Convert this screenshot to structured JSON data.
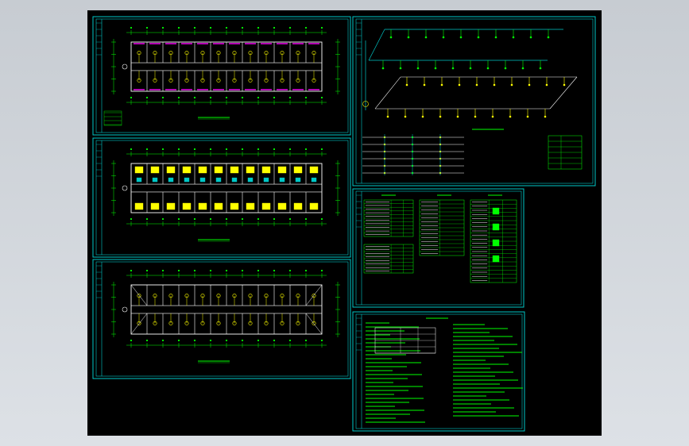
{
  "drawing": {
    "background_color": "#000000",
    "viewport_color": "#cfd4da",
    "frame_color": "#00c8c8",
    "line_color": "#ffff00",
    "text_color": "#00ff00",
    "accent_color": "#ff00ff",
    "white_color": "#ffffff",
    "sheets": [
      {
        "name": "floor-plan-upper"
      },
      {
        "name": "floor-plan-middle"
      },
      {
        "name": "floor-plan-lower"
      },
      {
        "name": "riser-diagram"
      },
      {
        "name": "equipment-tables"
      },
      {
        "name": "design-notes"
      }
    ]
  }
}
